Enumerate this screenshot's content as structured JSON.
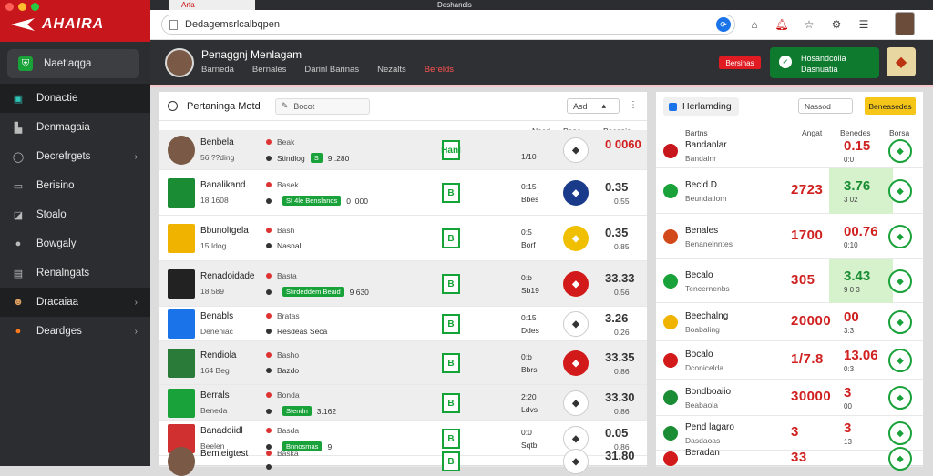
{
  "window": {
    "tab1": "Arfa",
    "tab2": "Deshandis"
  },
  "brand": {
    "name": "AHAIRA"
  },
  "sidebar": {
    "items": [
      {
        "label": "Naetlaqga",
        "icon": "shield-icon"
      },
      {
        "label": "Donactie",
        "icon": "grid-icon"
      },
      {
        "label": "Denmagaia",
        "icon": "bag-icon"
      },
      {
        "label": "Decrefrgets",
        "icon": "ring-icon"
      },
      {
        "label": "Berisino",
        "icon": "monitor-icon"
      },
      {
        "label": "Stoalo",
        "icon": "chart-icon"
      },
      {
        "label": "Bowgaly",
        "icon": "ball-icon"
      },
      {
        "label": "Renalngats",
        "icon": "list-icon"
      },
      {
        "label": "Dracaiaa",
        "icon": "avatar-icon"
      },
      {
        "label": "Deardges",
        "icon": "orange-icon"
      }
    ]
  },
  "topbar": {
    "url": "Dedagemsrlcalbqpen"
  },
  "header": {
    "name": "Penaggnj Menlagam",
    "meta": [
      "Barneda",
      "Bernales",
      "Darinl Barinas",
      "Nezalts",
      "Berelds"
    ],
    "btn_red": "Bersinas",
    "btn_green": [
      "Hosandcolia",
      "Dasnuatia"
    ]
  },
  "main": {
    "title": "Pertaninga Motd",
    "search": "Bocot",
    "filter": "Asd",
    "cols": [
      "Nasd",
      "Pena",
      "Boconie"
    ],
    "rows": [
      {
        "t1": "Benbela",
        "t2": "56 ??ding",
        "s1": "Beak",
        "s2": "Stindlog",
        "pill": "S",
        "extra": "9 .280",
        "g": "Hanl",
        "mid1": "",
        "mid2": "1/10",
        "odd": "0 0060",
        "odd2": ""
      },
      {
        "t1": "Banalikand",
        "t2": "18.1608",
        "s1": "Basek",
        "s2": "",
        "pill": "St 4le Benslands",
        "extra": "0 .000",
        "g": "B",
        "mid1": "0:15",
        "mid2": "Bbes",
        "odd": "0.35",
        "odd2": "0.55"
      },
      {
        "t1": "Bbunoltgela",
        "t2": "15 Idog",
        "s1": "Bash",
        "s2": "Nasnal",
        "pill": "",
        "extra": "",
        "g": "B",
        "mid1": "0:5",
        "mid2": "Borf",
        "odd": "0.35",
        "odd2": "0.85"
      },
      {
        "t1": "Renadoidade",
        "t2": "18.589",
        "s1": "Basta",
        "s2": "",
        "pill": "Stirdeddem Beaid",
        "extra": "9 630",
        "g": "B",
        "mid1": "0:b",
        "mid2": "Sb19",
        "odd": "33.33",
        "odd2": "0.56"
      },
      {
        "t1": "Benabls",
        "t2": "Deneniac",
        "s1": "Bratas",
        "s2": "Resdeas Seca",
        "pill": "",
        "extra": "",
        "g": "B",
        "mid1": "0:15",
        "mid2": "Ddes",
        "odd": "3.26",
        "odd2": "0.26"
      },
      {
        "t1": "Rendiola",
        "t2": "164 Beg",
        "s1": "Basho",
        "s2": "Bazdo",
        "pill": "",
        "extra": "",
        "g": "B",
        "mid1": "0:b",
        "mid2": "Bbrs",
        "odd": "33.35",
        "odd2": "0.86"
      },
      {
        "t1": "Berrals",
        "t2": "Beneda",
        "s1": "Bonda",
        "s2": "",
        "pill": "Stendn",
        "extra": "3.162",
        "g": "B",
        "mid1": "2:20",
        "mid2": "Ldvs",
        "odd": "33.30",
        "odd2": "0.86"
      },
      {
        "t1": "Banadoiidl",
        "t2": "Beelen",
        "s1": "Basda",
        "s2": "",
        "pill": "Bnnosmas",
        "extra": "9",
        "g": "B",
        "mid1": "0:0",
        "mid2": "Sqtb",
        "odd": "0.05",
        "odd2": "0.86"
      },
      {
        "t1": "Bemleigtest",
        "t2": "",
        "s1": "Baska",
        "s2": "",
        "pill": "",
        "extra": "",
        "g": "B",
        "mid1": "",
        "mid2": "",
        "odd": "31.80",
        "odd2": ""
      }
    ]
  },
  "right": {
    "title": "Herlamding",
    "select": "Nassod",
    "btn": "Beneasedes",
    "cols": [
      "Bartns",
      "Angat",
      "Benedes",
      "Borsa"
    ],
    "rows": [
      {
        "n1": "Bandanlar",
        "n2": "Bandalnr",
        "big": "",
        "v": "0.15",
        "g": false,
        "v2": "0:0",
        "hl": false
      },
      {
        "n1": "Becld D",
        "n2": "Beundatiom",
        "big": "2723",
        "v": "3.76",
        "g": true,
        "v2": "3 02",
        "hl": true
      },
      {
        "n1": "Benales",
        "n2": "Benanelnntes",
        "big": "1700",
        "v": "00.76",
        "g": false,
        "v2": "0:10",
        "hl": false
      },
      {
        "n1": "Becalo",
        "n2": "Tencernenbs",
        "big": "305",
        "v": "3.43",
        "g": true,
        "v2": "9 0 3",
        "hl": true
      },
      {
        "n1": "Beechalng",
        "n2": "Boabaling",
        "big": "20000",
        "v": "00",
        "g": false,
        "v2": "3:3",
        "hl": false
      },
      {
        "n1": "Bocalo",
        "n2": "Dconicelda",
        "big": "1/7.8",
        "v": "13.06",
        "g": false,
        "v2": "0:3",
        "hl": false
      },
      {
        "n1": "Bondboaiio",
        "n2": "Beabaola",
        "big": "30000",
        "v": "3",
        "g": false,
        "v2": "00",
        "hl": false
      },
      {
        "n1": "Pend lagaro",
        "n2": "Dasdaoas",
        "big": "3",
        "v": "3",
        "g": false,
        "v2": "13",
        "hl": false
      },
      {
        "n1": "Beradan",
        "n2": "",
        "big": "33",
        "v": "",
        "g": false,
        "v2": "",
        "hl": false
      }
    ]
  },
  "colors": {
    "brand_red": "#c8161d",
    "accent_green": "#1aa23a",
    "sidebar": "#2b2d30"
  }
}
